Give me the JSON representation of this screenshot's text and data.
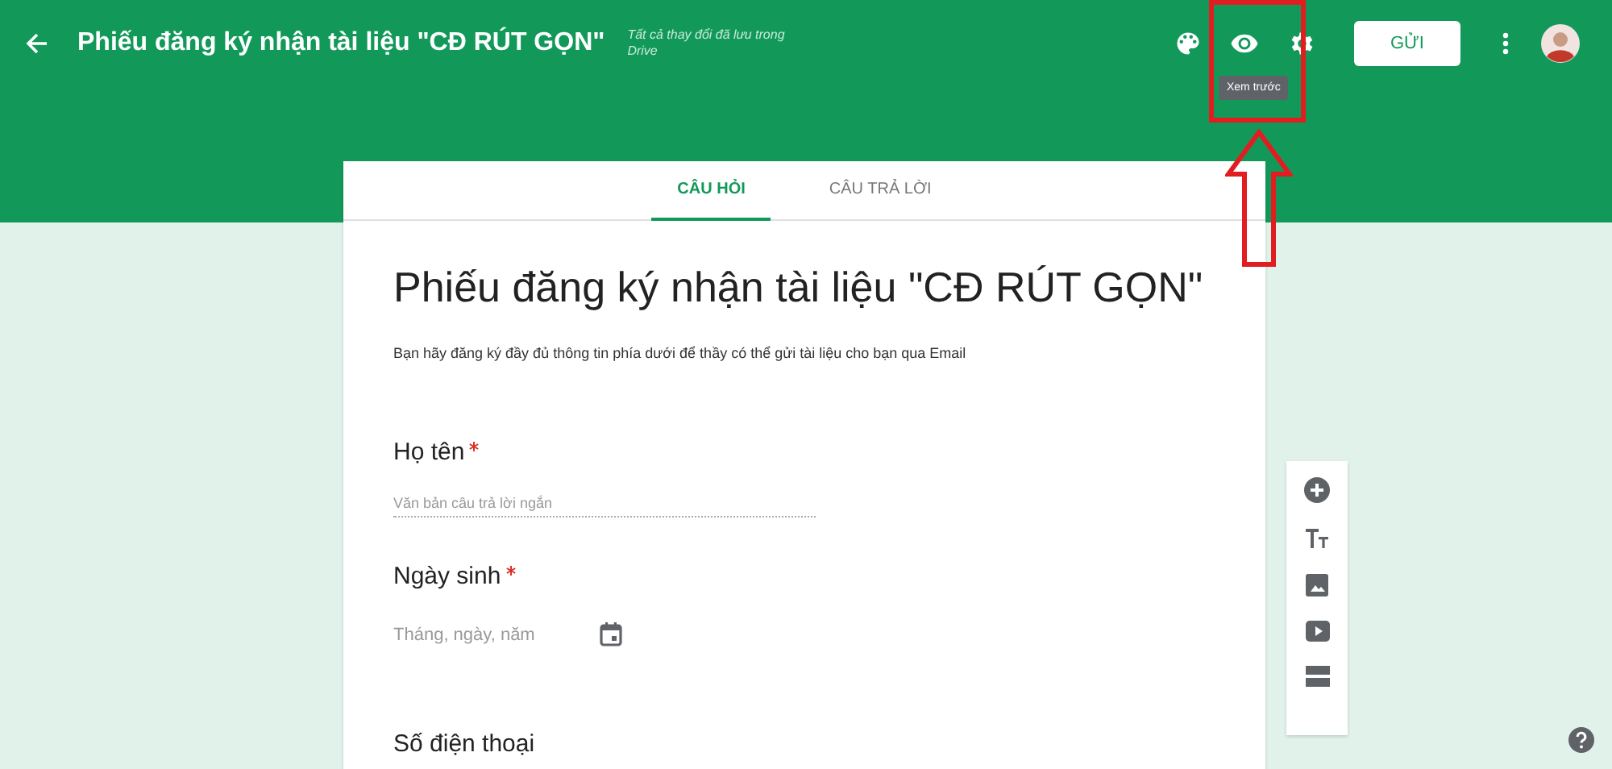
{
  "header": {
    "title": "Phiếu đăng ký nhận tài liệu \"CĐ RÚT GỌN\"",
    "save_status": "Tất cả thay đổi đã lưu trong Drive",
    "send_button": "GỬI",
    "tooltip": "Xem trước"
  },
  "tabs": [
    {
      "label": "CÂU HỎI",
      "selected": true
    },
    {
      "label": "CÂU TRẢ LỜI",
      "selected": false
    }
  ],
  "form": {
    "title": "Phiếu đăng ký nhận tài liệu \"CĐ RÚT GỌN\"",
    "description": "Bạn hãy đăng ký đầy đủ thông tin phía dưới để thầy có thể gửi tài liệu cho bạn qua Email"
  },
  "questions": [
    {
      "title": "Họ tên",
      "required": true,
      "kind": "short",
      "placeholder": "Văn bản câu trả lời ngắn"
    },
    {
      "title": "Ngày sinh",
      "required": true,
      "kind": "date",
      "placeholder": "Tháng, ngày, năm"
    },
    {
      "title": "Số điện thoại",
      "required": false
    }
  ]
}
